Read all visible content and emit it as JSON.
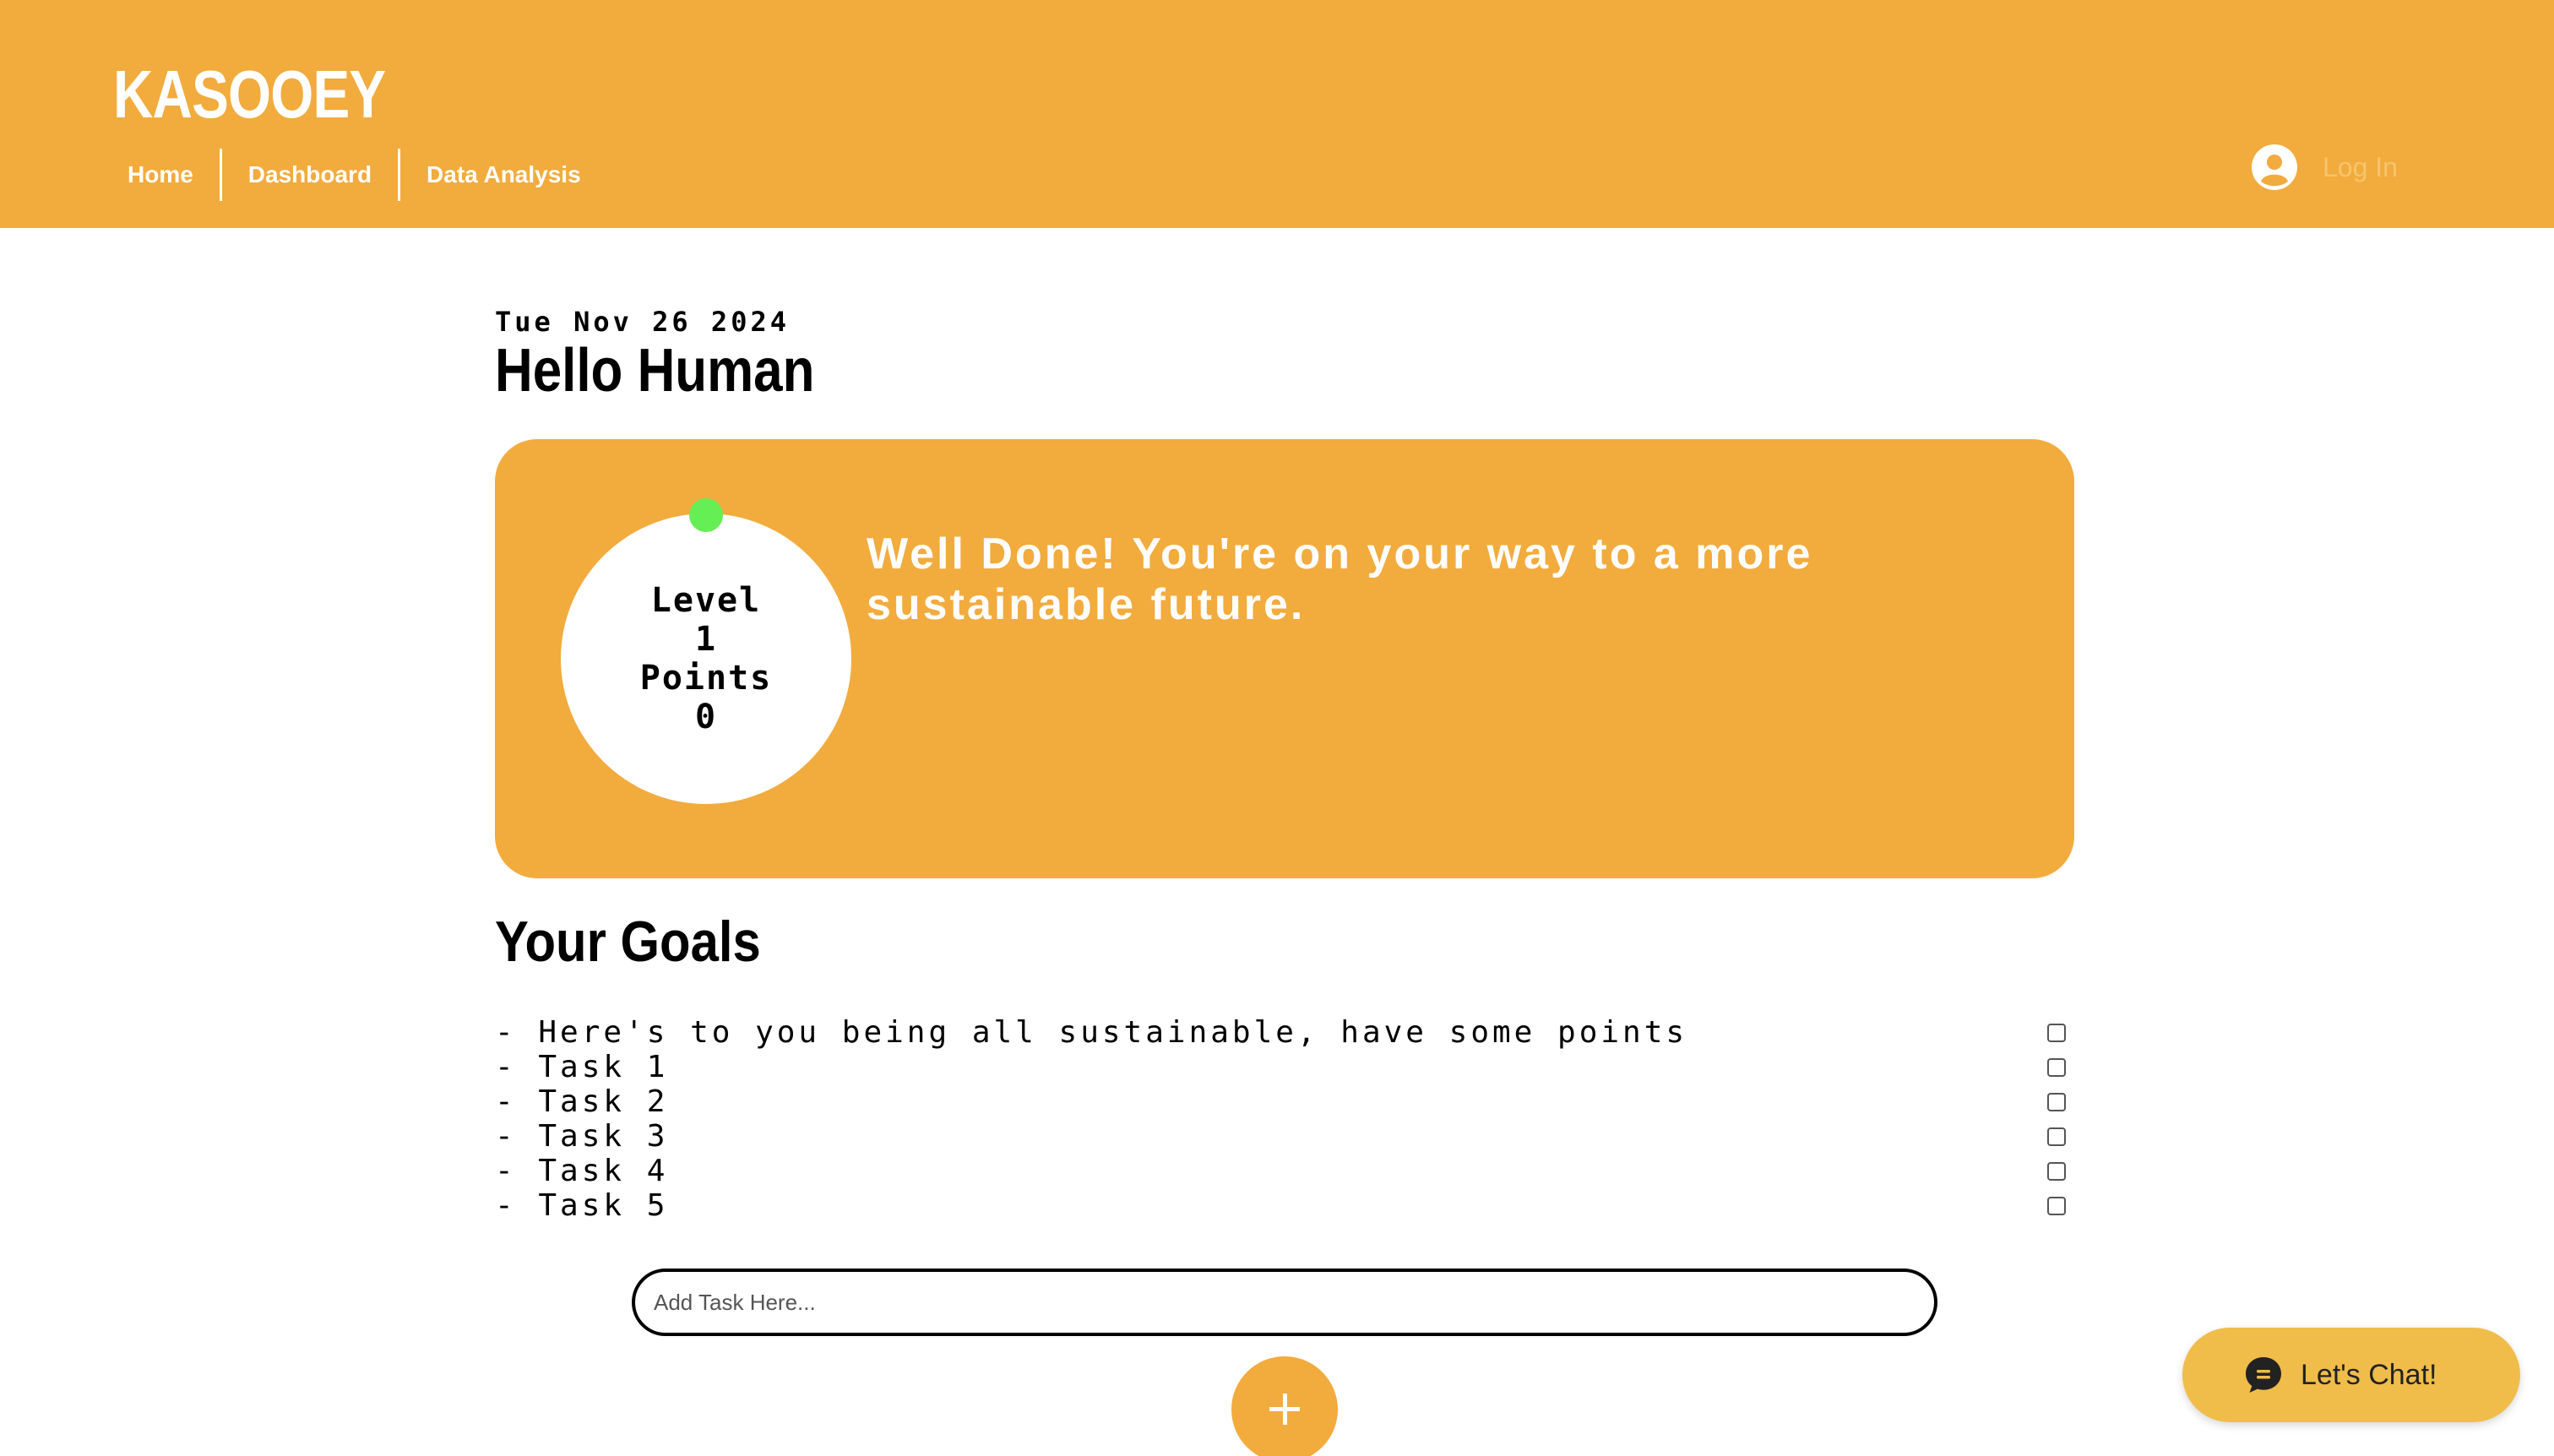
{
  "app": {
    "logo": "KASOOEY"
  },
  "nav": {
    "items": [
      {
        "label": "Home"
      },
      {
        "label": "Dashboard"
      },
      {
        "label": "Data Analysis"
      }
    ]
  },
  "auth": {
    "login_label": "Log In",
    "icon": "user-avatar-icon"
  },
  "main": {
    "date": "Tue Nov 26 2024",
    "greeting": "Hello Human",
    "level_card": {
      "level_label": "Level",
      "level_value": "1",
      "points_label": "Points",
      "points_value": "0",
      "message": "Well Done! You're on your way to a more sustainable future."
    },
    "goals": {
      "title": "Your Goals",
      "items": [
        {
          "text": "- Here's to you being all sustainable, have some points",
          "checked": false
        },
        {
          "text": "- Task 1",
          "checked": false
        },
        {
          "text": "- Task 2",
          "checked": false
        },
        {
          "text": "- Task 3",
          "checked": false
        },
        {
          "text": "- Task 4",
          "checked": false
        },
        {
          "text": "- Task 5",
          "checked": false
        }
      ]
    },
    "task_input": {
      "placeholder": "Add Task Here...",
      "value": ""
    },
    "add_button": {
      "icon": "plus-icon"
    }
  },
  "chat": {
    "label": "Let's Chat!",
    "icon": "chat-bubble-icon"
  },
  "colors": {
    "brand": "#F2AB3D",
    "progress_dot": "#66EE55",
    "chat": "#F0BD4A",
    "text": "#000000"
  }
}
